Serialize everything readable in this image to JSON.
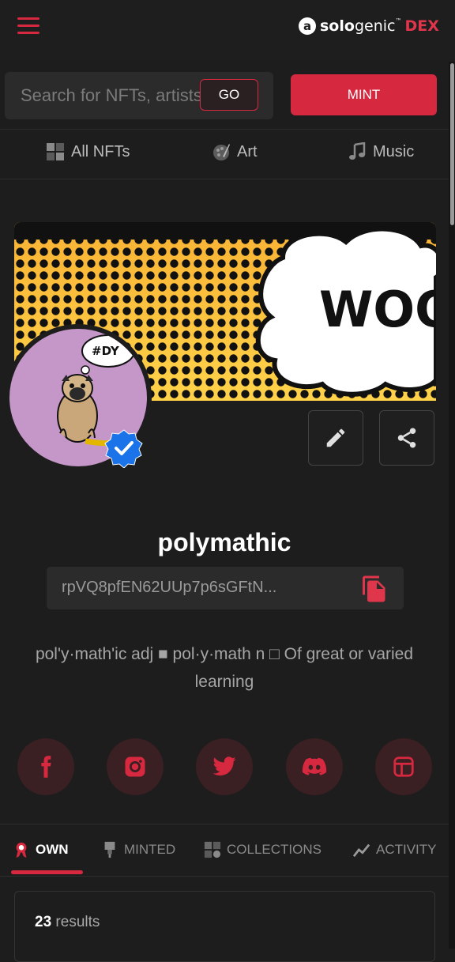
{
  "header": {
    "menu_icon": "hamburger-icon",
    "logo": {
      "mark": "a",
      "solo": "solo",
      "genic": "genic",
      "tm": "™",
      "dex": "DEX"
    }
  },
  "search": {
    "placeholder": "Search for NFTs, artists",
    "go_label": "GO"
  },
  "mint_label": "MINT",
  "categories": [
    {
      "label": "All NFTs",
      "icon": "grid-icon"
    },
    {
      "label": "Art",
      "icon": "palette-icon"
    },
    {
      "label": "Music",
      "icon": "music-note-icon"
    }
  ],
  "banner": {
    "text": "WOO"
  },
  "avatar": {
    "caption": "#DY",
    "verified": true
  },
  "profile": {
    "username": "polymathic",
    "address": "rpVQ8pfEN62UUp7p6sGFtN...",
    "bio": "pol'y·math'ic adj ■ pol·y·math n □ Of great or varied learning"
  },
  "socials": [
    "facebook-icon",
    "instagram-icon",
    "twitter-icon",
    "discord-icon",
    "website-icon"
  ],
  "tabs": [
    {
      "label": "OWN",
      "icon": "ribbon-icon",
      "active": true
    },
    {
      "label": "MINTED",
      "icon": "stamp-icon",
      "active": false
    },
    {
      "label": "COLLECTIONS",
      "icon": "collections-icon",
      "active": false
    },
    {
      "label": "ACTIVITY",
      "icon": "chart-line-icon",
      "active": false
    }
  ],
  "results": {
    "count": "23",
    "label": "results"
  },
  "colors": {
    "accent": "#d6283f",
    "background": "#1d1d1d",
    "panel": "#2b2b2b"
  }
}
